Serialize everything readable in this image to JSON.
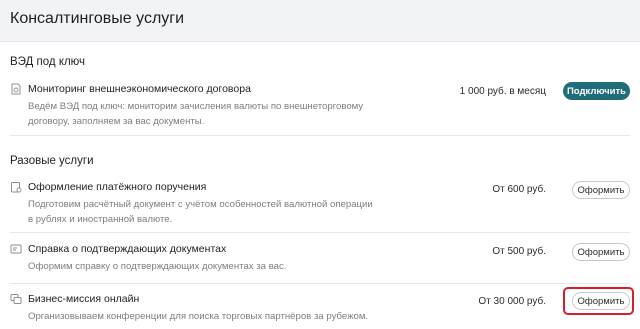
{
  "header": {
    "title": "Консалтинговые услуги"
  },
  "sections": [
    {
      "title": "ВЭД под ключ",
      "items": [
        {
          "title": "Мониторинг внешнеэкономического договора",
          "description": "Ведём ВЭД под ключ: мониторим зачисления валюты по внешнеторговому договору, заполняем за вас документы.",
          "price": "1 000 руб. в месяц",
          "button": "Подключить",
          "icon": "document-clock-icon"
        }
      ]
    },
    {
      "title": "Разовые услуги",
      "items": [
        {
          "title": "Оформление платёжного поручения",
          "description": "Подготовим расчётный документ с учётом особенностей валютной операции в рублях и иностранной валюте.",
          "price": "От 600 руб.",
          "button": "Оформить",
          "icon": "payment-order-icon"
        },
        {
          "title": "Справка о подтверждающих документах",
          "description": "Оформим справку о подтверждающих документах за вас.",
          "price": "От 500 руб.",
          "button": "Оформить",
          "icon": "certificate-icon"
        },
        {
          "title": "Бизнес-миссия онлайн",
          "description": "Организовываем конференции для поиска торговых партнёров за рубежом.",
          "price": "От 30 000 руб.",
          "button": "Оформить",
          "icon": "conference-icon"
        }
      ]
    }
  ],
  "colors": {
    "accent": "#1e6d78",
    "highlight": "#d4202a",
    "header_bg": "#f2f3f5"
  }
}
